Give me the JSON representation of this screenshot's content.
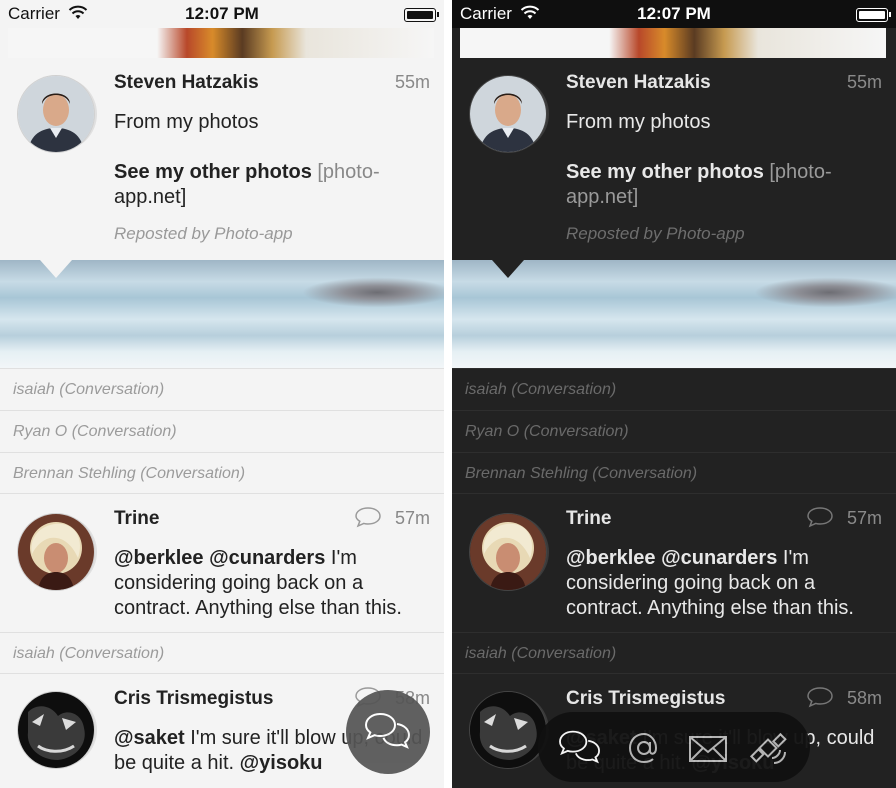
{
  "status_bar": {
    "carrier": "Carrier",
    "time": "12:07 PM"
  },
  "posts": [
    {
      "author": "Steven Hatzakis",
      "time": "55m",
      "line1": "From my photos",
      "link_text": "See my other photos",
      "link_url_part1": " [photo-",
      "link_url_part2": "app.net]",
      "repost": "Reposted by Photo-app"
    },
    {
      "author": "Trine",
      "time": "57m",
      "mention1": "@berklee",
      "mention2": "@cunarders",
      "text_a": " I'm",
      "text_b": "considering going back on a",
      "text_c": "contract. Anything else than this."
    },
    {
      "author": "Cris Trismegistus",
      "time": "58m",
      "mention1": "@saket",
      "text_a": " I'm sure it'll blow up, could",
      "text_b": "be quite a hit. ",
      "mention2": "@yisoku"
    }
  ],
  "conversations": [
    "isaiah (Conversation)",
    "Ryan O (Conversation)",
    "Brennan Stehling (Conversation)",
    "isaiah (Conversation)"
  ],
  "icons": {
    "wifi": "wifi-icon",
    "battery": "battery-icon",
    "reply": "speech-bubble-icon",
    "fab": "conversations-icon",
    "tabs": [
      "conversations-icon",
      "at-mention-icon",
      "envelope-icon",
      "satellite-icon"
    ]
  },
  "colors": {
    "light_bg": "#f4f4f4",
    "dark_bg": "#222222",
    "accent_fab": "#555555",
    "muted_text": "#888888"
  }
}
